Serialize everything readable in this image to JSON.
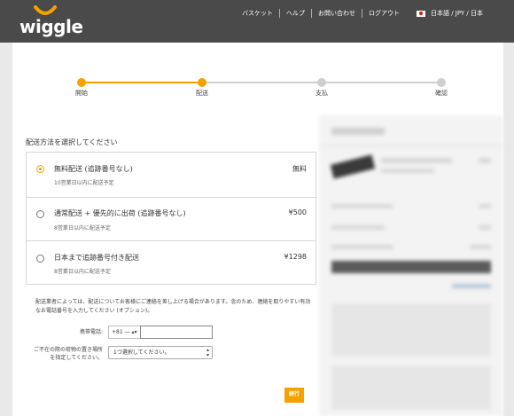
{
  "header": {
    "logo_text": "wiggle",
    "nav": [
      "バスケット",
      "ヘルプ",
      "お問い合わせ",
      "ログアウト"
    ],
    "language": "日本語 / JPY / 日本",
    "accent_color": "#f5a100",
    "background_color": "#4a4a4a"
  },
  "progress": {
    "steps": [
      {
        "label": "開始",
        "state": "done"
      },
      {
        "label": "配送",
        "state": "current"
      },
      {
        "label": "支払",
        "state": "pending"
      },
      {
        "label": "確認",
        "state": "pending"
      }
    ],
    "active_color": "#f5a100",
    "inactive_color": "#cccccc"
  },
  "shipping": {
    "section_title": "配送方法を選択してください",
    "options": [
      {
        "title": "無料配送 (追跡番号なし)",
        "sub": "10営業日以内に配送予定",
        "price": "無料",
        "selected": true
      },
      {
        "title": "通常配送 + 優先的に出荷 (追跡番号なし)",
        "sub": "8営業日以内に配送予定",
        "price": "¥500",
        "selected": false
      },
      {
        "title": "日本まで追跡番号付き配送",
        "sub": "8営業日以内に配送予定",
        "price": "¥1298",
        "selected": false
      }
    ]
  },
  "contact": {
    "notice": "配送業者によっては、配送についてお客様にご連絡を差し上げる場合があります。念のため、連絡を取りやすい有効なお電話番号を入力してください (オプション)。",
    "phone_label": "携帯電話:",
    "phone_prefix": "+81 ― ▴▾",
    "phone_value": "",
    "absence_label": "ご不在の際の荷物の置き場所を指定してください。",
    "absence_value": "1つ選択してください。"
  },
  "continue_label": "続行"
}
